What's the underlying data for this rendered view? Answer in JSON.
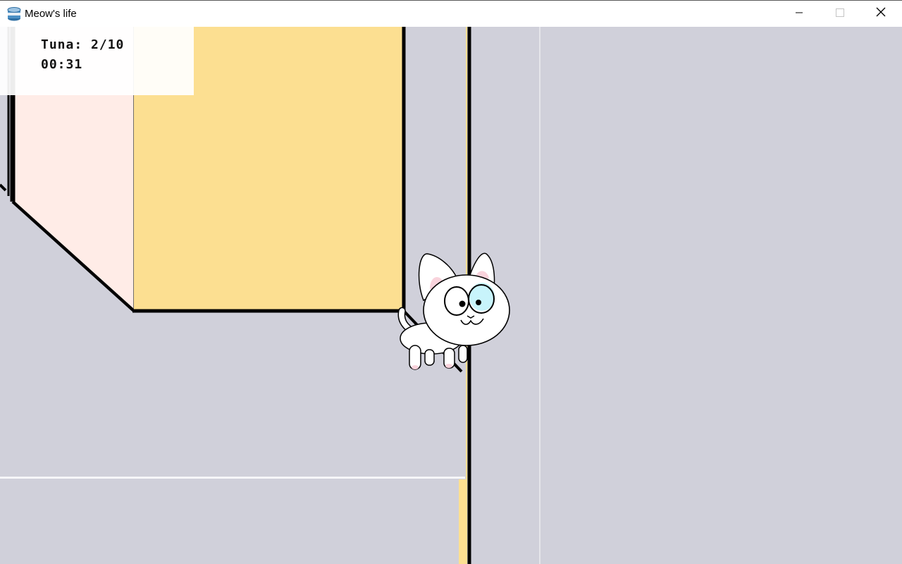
{
  "window": {
    "title": "Meow's life",
    "icon": "tuna-can-icon",
    "controls": [
      "minimize-icon",
      "maximize-icon",
      "close-icon"
    ]
  },
  "hud": {
    "tuna_label": "Tuna:",
    "tuna_collected": 2,
    "tuna_total": 10,
    "tuna_text": "Tuna: 2/10",
    "timer": "00:31"
  },
  "colors": {
    "floor": "#d0d0da",
    "yellow_box": "#fcdf91",
    "pink_wall": "#ffece7",
    "outline": "#000000",
    "cat_eye_patch": "#c8f4fb",
    "cat_ear_inner": "#f9d3dc"
  },
  "player": {
    "name": "cat",
    "facing": "right"
  }
}
